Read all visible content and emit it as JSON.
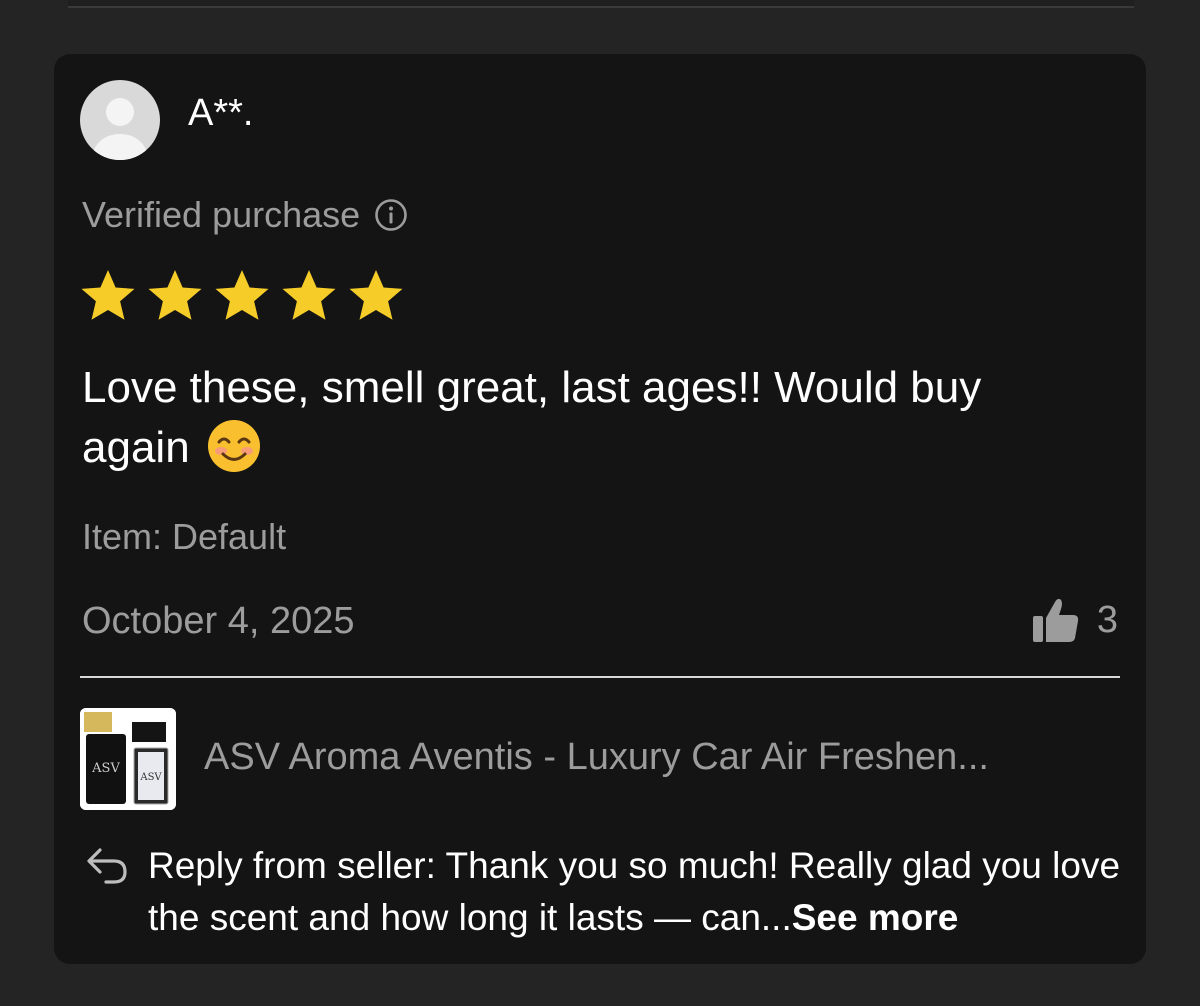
{
  "review": {
    "reviewer_name": "A**.",
    "verified_label": "Verified purchase",
    "rating": 5,
    "rating_max": 5,
    "text": "Love these, smell great, last ages!! Would buy again",
    "emoji": "smiling-face-emoji",
    "item_label": "Item: Default",
    "date": "October 4, 2025",
    "likes": "3"
  },
  "product": {
    "title": "ASV Aroma Aventis - Luxury Car Air Freshen...",
    "thumb_brand": "ASV"
  },
  "reply": {
    "text": "Reply from seller: Thank you so much! Really glad you love the scent and how long it lasts — can...",
    "see_more": "See more"
  },
  "colors": {
    "background": "#242424",
    "card": "#141414",
    "star": "#f5cc28",
    "muted_text": "#9c9c9c",
    "text": "#ffffff"
  },
  "icons": [
    "info-icon",
    "star-icon",
    "thumbs-up-icon",
    "reply-icon",
    "avatar-placeholder-icon"
  ]
}
